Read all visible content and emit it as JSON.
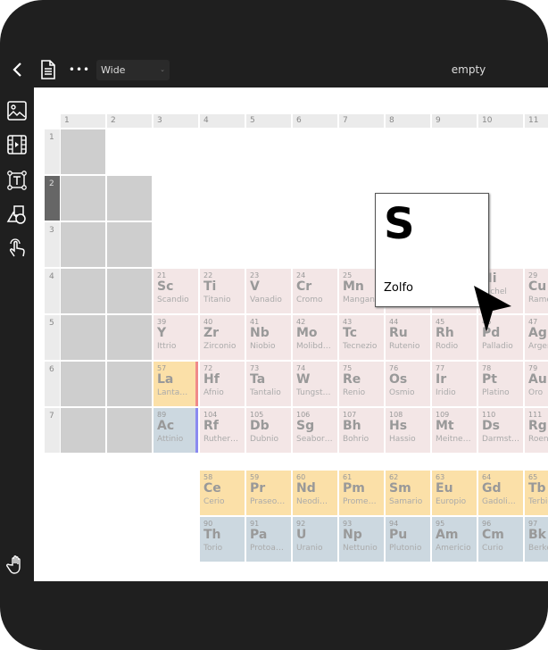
{
  "topbar": {
    "back_icon": "chevron-left-icon",
    "doc_icon": "document-icon",
    "more_icon": "ellipsis-icon",
    "layout_select": "Wide",
    "title": "empty"
  },
  "sidebar": {
    "items": [
      "image-icon",
      "video-icon",
      "text-box-icon",
      "shapes-icon",
      "touch-gesture-icon"
    ],
    "bottom": "hand-icon"
  },
  "column_headers": [
    "1",
    "2",
    "3",
    "4",
    "5",
    "6",
    "7",
    "8",
    "9",
    "10",
    "11"
  ],
  "row_headers": [
    "1",
    "2",
    "3",
    "4",
    "5",
    "6",
    "7"
  ],
  "selected_row": "2",
  "elements": [
    {
      "n": "21",
      "s": "Sc",
      "name": "Scandio",
      "row": 4,
      "col": 3
    },
    {
      "n": "22",
      "s": "Ti",
      "name": "Titanio",
      "row": 4,
      "col": 4
    },
    {
      "n": "23",
      "s": "V",
      "name": "Vanadio",
      "row": 4,
      "col": 5
    },
    {
      "n": "24",
      "s": "Cr",
      "name": "Cromo",
      "row": 4,
      "col": 6
    },
    {
      "n": "25",
      "s": "Mn",
      "name": "Mangan…",
      "row": 4,
      "col": 7
    },
    {
      "n": "",
      "s": "",
      "name": "",
      "row": 4,
      "col": 8
    },
    {
      "n": "",
      "s": "",
      "name": "",
      "row": 4,
      "col": 9
    },
    {
      "n": "",
      "s": "Ni",
      "name": "Nichel",
      "row": 4,
      "col": 10
    },
    {
      "n": "29",
      "s": "Cu",
      "name": "Rame",
      "row": 4,
      "col": 11
    },
    {
      "n": "39",
      "s": "Y",
      "name": "Ittrio",
      "row": 5,
      "col": 3
    },
    {
      "n": "40",
      "s": "Zr",
      "name": "Zirconio",
      "row": 5,
      "col": 4
    },
    {
      "n": "41",
      "s": "Nb",
      "name": "Niobio",
      "row": 5,
      "col": 5
    },
    {
      "n": "42",
      "s": "Mo",
      "name": "Molibd…",
      "row": 5,
      "col": 6
    },
    {
      "n": "43",
      "s": "Tc",
      "name": "Tecnezio",
      "row": 5,
      "col": 7
    },
    {
      "n": "44",
      "s": "Ru",
      "name": "Rutenio",
      "row": 5,
      "col": 8
    },
    {
      "n": "45",
      "s": "Rh",
      "name": "Rodio",
      "row": 5,
      "col": 9
    },
    {
      "n": "46",
      "s": "Pd",
      "name": "Palladio",
      "row": 5,
      "col": 10
    },
    {
      "n": "47",
      "s": "Ag",
      "name": "Argento",
      "row": 5,
      "col": 11
    },
    {
      "n": "57",
      "s": "La",
      "name": "Lanta…",
      "row": 6,
      "col": 3,
      "type": "lan"
    },
    {
      "n": "72",
      "s": "Hf",
      "name": "Afnio",
      "row": 6,
      "col": 4
    },
    {
      "n": "73",
      "s": "Ta",
      "name": "Tantalio",
      "row": 6,
      "col": 5
    },
    {
      "n": "74",
      "s": "W",
      "name": "Tungst…",
      "row": 6,
      "col": 6
    },
    {
      "n": "75",
      "s": "Re",
      "name": "Renio",
      "row": 6,
      "col": 7
    },
    {
      "n": "76",
      "s": "Os",
      "name": "Osmio",
      "row": 6,
      "col": 8
    },
    {
      "n": "77",
      "s": "Ir",
      "name": "Iridio",
      "row": 6,
      "col": 9
    },
    {
      "n": "78",
      "s": "Pt",
      "name": "Platino",
      "row": 6,
      "col": 10
    },
    {
      "n": "79",
      "s": "Au",
      "name": "Oro",
      "row": 6,
      "col": 11
    },
    {
      "n": "89",
      "s": "Ac",
      "name": "Attinio",
      "row": 7,
      "col": 3,
      "type": "act"
    },
    {
      "n": "104",
      "s": "Rf",
      "name": "Ruther…",
      "row": 7,
      "col": 4
    },
    {
      "n": "105",
      "s": "Db",
      "name": "Dubnio",
      "row": 7,
      "col": 5
    },
    {
      "n": "106",
      "s": "Sg",
      "name": "Seabor…",
      "row": 7,
      "col": 6
    },
    {
      "n": "107",
      "s": "Bh",
      "name": "Bohrio",
      "row": 7,
      "col": 7
    },
    {
      "n": "108",
      "s": "Hs",
      "name": "Hassio",
      "row": 7,
      "col": 8
    },
    {
      "n": "109",
      "s": "Mt",
      "name": "Meitne…",
      "row": 7,
      "col": 9
    },
    {
      "n": "110",
      "s": "Ds",
      "name": "Darmst…",
      "row": 7,
      "col": 10
    },
    {
      "n": "111",
      "s": "Rg",
      "name": "Roentgenio",
      "row": 7,
      "col": 11
    },
    {
      "n": "58",
      "s": "Ce",
      "name": "Cerio",
      "row": 9,
      "col": 4,
      "type": "lan"
    },
    {
      "n": "59",
      "s": "Pr",
      "name": "Praseo…",
      "row": 9,
      "col": 5,
      "type": "lan"
    },
    {
      "n": "60",
      "s": "Nd",
      "name": "Neodi…",
      "row": 9,
      "col": 6,
      "type": "lan"
    },
    {
      "n": "61",
      "s": "Pm",
      "name": "Prome…",
      "row": 9,
      "col": 7,
      "type": "lan"
    },
    {
      "n": "62",
      "s": "Sm",
      "name": "Samario",
      "row": 9,
      "col": 8,
      "type": "lan"
    },
    {
      "n": "63",
      "s": "Eu",
      "name": "Europio",
      "row": 9,
      "col": 9,
      "type": "lan"
    },
    {
      "n": "64",
      "s": "Gd",
      "name": "Gadoli…",
      "row": 9,
      "col": 10,
      "type": "lan"
    },
    {
      "n": "65",
      "s": "Tb",
      "name": "Terbio",
      "row": 9,
      "col": 11,
      "type": "lan"
    },
    {
      "n": "90",
      "s": "Th",
      "name": "Torio",
      "row": 10,
      "col": 4,
      "type": "act"
    },
    {
      "n": "91",
      "s": "Pa",
      "name": "Protoa…",
      "row": 10,
      "col": 5,
      "type": "act"
    },
    {
      "n": "92",
      "s": "U",
      "name": "Uranio",
      "row": 10,
      "col": 6,
      "type": "act"
    },
    {
      "n": "93",
      "s": "Np",
      "name": "Nettunio",
      "row": 10,
      "col": 7,
      "type": "act"
    },
    {
      "n": "94",
      "s": "Pu",
      "name": "Plutonio",
      "row": 10,
      "col": 8,
      "type": "act"
    },
    {
      "n": "95",
      "s": "Am",
      "name": "Americio",
      "row": 10,
      "col": 9,
      "type": "act"
    },
    {
      "n": "96",
      "s": "Cm",
      "name": "Curio",
      "row": 10,
      "col": 10,
      "type": "act"
    },
    {
      "n": "97",
      "s": "Bk",
      "name": "Berkelio",
      "row": 10,
      "col": 11,
      "type": "act"
    }
  ],
  "popup": {
    "symbol": "S",
    "name": "Zolfo"
  },
  "colors": {
    "transition": "#f3e6e6",
    "lanthanide": "#fbe0a8",
    "actinide": "#ccd8e0",
    "frame": "#1f1f1f"
  }
}
